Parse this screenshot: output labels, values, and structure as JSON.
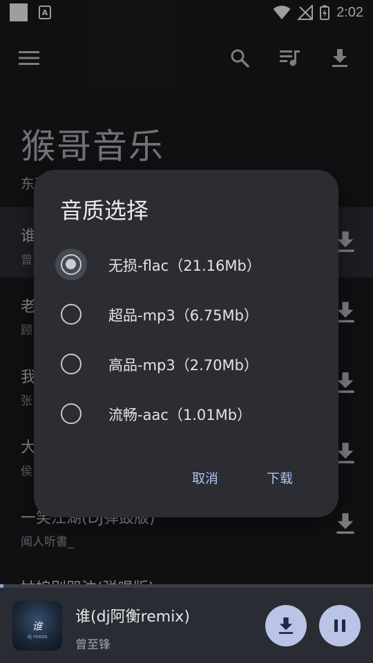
{
  "status_bar": {
    "time": "2:02",
    "notification_icon_letter": "A"
  },
  "header": {
    "app_title": "猴哥音乐",
    "subtitle": "东莞"
  },
  "songs": [
    {
      "title": "谁",
      "artist": "曾"
    },
    {
      "title": "老",
      "artist": "顾"
    },
    {
      "title": "我",
      "artist": "张"
    },
    {
      "title": "大",
      "artist": "侯"
    },
    {
      "title": "一笑江湖(DJ弹鼓版)",
      "artist": "闻人听書_"
    },
    {
      "title": "姑娘别哭泣(弹唱版)",
      "artist": ""
    }
  ],
  "dialog": {
    "title": "音质选择",
    "selected_index": 0,
    "options": [
      {
        "label": "无损-flac（21.16Mb）"
      },
      {
        "label": "超品-mp3（6.75Mb）"
      },
      {
        "label": "高品-mp3（2.70Mb）"
      },
      {
        "label": "流畅-aac（1.01Mb）"
      }
    ],
    "cancel_label": "取消",
    "confirm_label": "下载"
  },
  "player": {
    "title": "谁(dj阿衡remix)",
    "artist": "曾至锋",
    "cover_text": "谁",
    "cover_subtext": "dj remix",
    "progress": 0.01
  },
  "colors": {
    "background": "#1a1b1e",
    "dialog": "#2b2d33",
    "accent": "#aec4f2",
    "fab": "#b9c4e6"
  }
}
